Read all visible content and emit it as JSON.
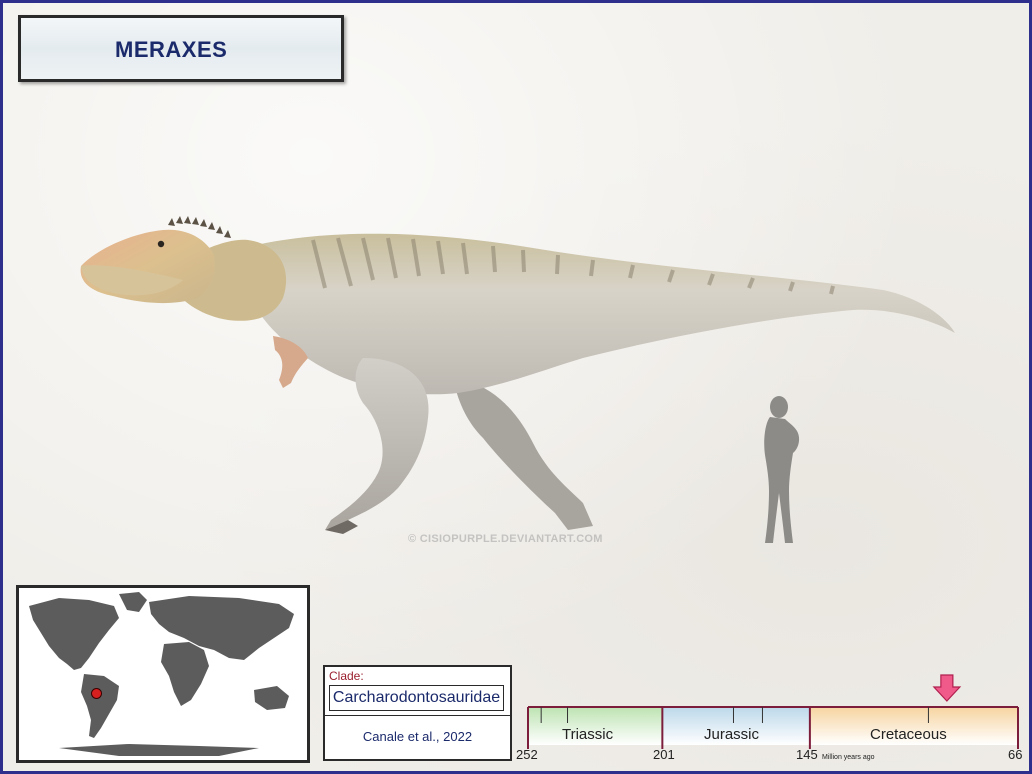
{
  "title": "MERAXES",
  "watermark": "© CISIOPURPLE.DEVIANTART.COM",
  "map": {
    "locality_color": "#d61f1f"
  },
  "clade": {
    "label": "Clade:",
    "name": "Carcharodontosauridae",
    "citation": "Canale et al., 2022"
  },
  "timeline": {
    "periods": [
      {
        "name": "Triassic",
        "start": 252,
        "end": 201,
        "color": "#bde3b2"
      },
      {
        "name": "Jurassic",
        "start": 201,
        "end": 145,
        "color": "#bcd8ea"
      },
      {
        "name": "Cretaceous",
        "start": 145,
        "end": 66,
        "color": "#f6d4a0"
      }
    ],
    "boundaries": [
      "252",
      "201",
      "145",
      "66"
    ],
    "unit": "Million years ago",
    "marker_ma": 93,
    "axis_color": "#7d1d3c",
    "marker_color": "#f05a8a"
  }
}
